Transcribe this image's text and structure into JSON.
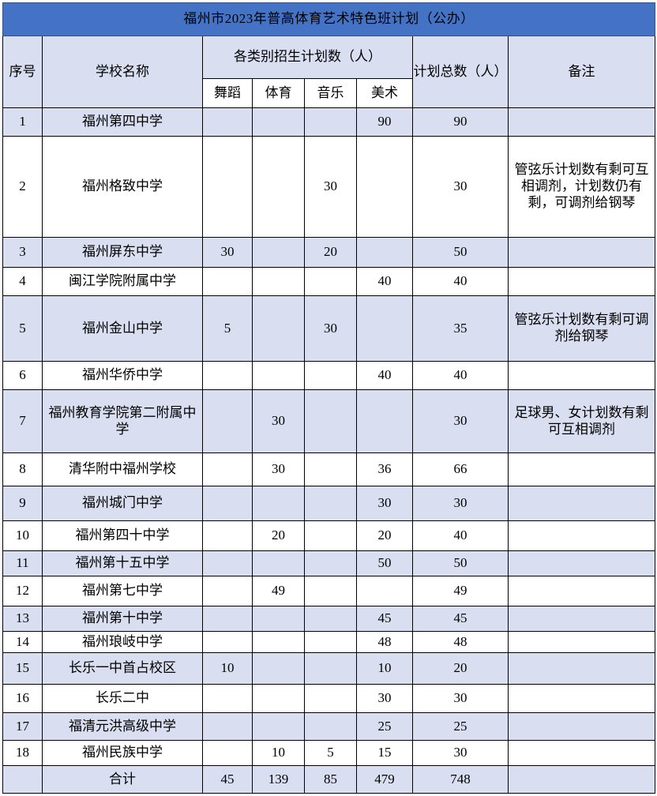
{
  "title": "福州市2023年普高体育艺术特色班计划（公办）",
  "theme": {
    "title_bar_color": "#4472C4",
    "title_text_color": "#FFFFFF",
    "tint_row_color": "#D9DEF0",
    "plain_row_color": "#FFFFFF",
    "border_color": "#000000"
  },
  "header": {
    "index": "序号",
    "school": "学校名称",
    "category_group": "各类别招生计划数（人）",
    "plan_total": "计划总数（人）",
    "remark": "备注",
    "subcolumns": [
      "舞蹈",
      "体育",
      "音乐",
      "美术"
    ]
  },
  "chart_data": {
    "type": "table",
    "title": "福州市2023年普高体育艺术特色班计划（公办）",
    "columns": [
      "序号",
      "学校名称",
      "舞蹈",
      "体育",
      "音乐",
      "美术",
      "计划总数（人）",
      "备注"
    ],
    "rows": [
      {
        "index": "1",
        "school": "福州第四中学",
        "dance": "",
        "sport": "",
        "music": "",
        "art": "90",
        "total": "90",
        "remark": ""
      },
      {
        "index": "2",
        "school": "福州格致中学",
        "dance": "",
        "sport": "",
        "music": "30",
        "art": "",
        "total": "30",
        "remark": "管弦乐计划数有剩可互相调剂，计划数仍有剩，可调剂给钢琴"
      },
      {
        "index": "3",
        "school": "福州屏东中学",
        "dance": "30",
        "sport": "",
        "music": "20",
        "art": "",
        "total": "50",
        "remark": ""
      },
      {
        "index": "4",
        "school": "闽江学院附属中学",
        "dance": "",
        "sport": "",
        "music": "",
        "art": "40",
        "total": "40",
        "remark": ""
      },
      {
        "index": "5",
        "school": "福州金山中学",
        "dance": "5",
        "sport": "",
        "music": "30",
        "art": "",
        "total": "35",
        "remark": "管弦乐计划数有剩可调剂给钢琴"
      },
      {
        "index": "6",
        "school": "福州华侨中学",
        "dance": "",
        "sport": "",
        "music": "",
        "art": "40",
        "total": "40",
        "remark": ""
      },
      {
        "index": "7",
        "school": "福州教育学院第二附属中学",
        "dance": "",
        "sport": "30",
        "music": "",
        "art": "",
        "total": "30",
        "remark": "足球男、女计划数有剩可互相调剂"
      },
      {
        "index": "8",
        "school": "清华附中福州学校",
        "dance": "",
        "sport": "30",
        "music": "",
        "art": "36",
        "total": "66",
        "remark": ""
      },
      {
        "index": "9",
        "school": "福州城门中学",
        "dance": "",
        "sport": "",
        "music": "",
        "art": "30",
        "total": "30",
        "remark": ""
      },
      {
        "index": "10",
        "school": "福州第四十中学",
        "dance": "",
        "sport": "20",
        "music": "",
        "art": "20",
        "total": "40",
        "remark": ""
      },
      {
        "index": "11",
        "school": "福州第十五中学",
        "dance": "",
        "sport": "",
        "music": "",
        "art": "50",
        "total": "50",
        "remark": ""
      },
      {
        "index": "12",
        "school": "福州第七中学",
        "dance": "",
        "sport": "49",
        "music": "",
        "art": "",
        "total": "49",
        "remark": ""
      },
      {
        "index": "13",
        "school": "福州第十中学",
        "dance": "",
        "sport": "",
        "music": "",
        "art": "45",
        "total": "45",
        "remark": ""
      },
      {
        "index": "14",
        "school": "福州琅岐中学",
        "dance": "",
        "sport": "",
        "music": "",
        "art": "48",
        "total": "48",
        "remark": ""
      },
      {
        "index": "15",
        "school": "长乐一中首占校区",
        "dance": "10",
        "sport": "",
        "music": "",
        "art": "10",
        "total": "20",
        "remark": ""
      },
      {
        "index": "16",
        "school": "长乐二中",
        "dance": "",
        "sport": "",
        "music": "",
        "art": "30",
        "total": "30",
        "remark": ""
      },
      {
        "index": "17",
        "school": "福清元洪高级中学",
        "dance": "",
        "sport": "",
        "music": "",
        "art": "25",
        "total": "25",
        "remark": ""
      },
      {
        "index": "18",
        "school": "福州民族中学",
        "dance": "",
        "sport": "10",
        "music": "5",
        "art": "15",
        "total": "30",
        "remark": ""
      }
    ],
    "total_row": {
      "label": "合计",
      "dance": "45",
      "sport": "139",
      "music": "85",
      "art": "479",
      "total": "748",
      "remark": ""
    }
  }
}
